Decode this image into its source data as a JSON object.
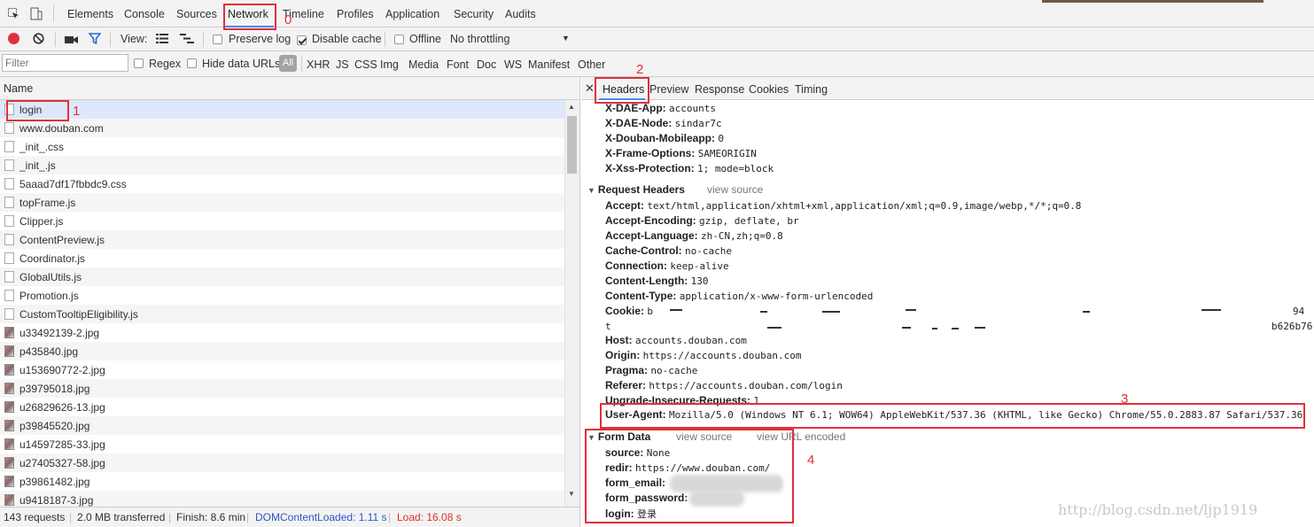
{
  "devtools": {
    "tabs": [
      "Elements",
      "Console",
      "Sources",
      "Network",
      "Timeline",
      "Profiles",
      "Application",
      "Security",
      "Audits"
    ],
    "active_tab": "Network"
  },
  "controls": {
    "view_label": "View:",
    "preserve_log": "Preserve log",
    "disable_cache": "Disable cache",
    "offline": "Offline",
    "throttling": "No throttling"
  },
  "filter": {
    "placeholder": "Filter",
    "regex": "Regex",
    "hide_data_urls": "Hide data URLs",
    "types": [
      "All",
      "XHR",
      "JS",
      "CSS",
      "Img",
      "Media",
      "Font",
      "Doc",
      "WS",
      "Manifest",
      "Other"
    ]
  },
  "requests": {
    "column_name": "Name",
    "items": [
      {
        "name": "login",
        "kind": "doc"
      },
      {
        "name": "www.douban.com",
        "kind": "doc"
      },
      {
        "name": "_init_.css",
        "kind": "doc"
      },
      {
        "name": "_init_.js",
        "kind": "doc"
      },
      {
        "name": "5aaad7df17fbbdc9.css",
        "kind": "doc"
      },
      {
        "name": "topFrame.js",
        "kind": "doc"
      },
      {
        "name": "Clipper.js",
        "kind": "doc"
      },
      {
        "name": "ContentPreview.js",
        "kind": "doc"
      },
      {
        "name": "Coordinator.js",
        "kind": "doc"
      },
      {
        "name": "GlobalUtils.js",
        "kind": "doc"
      },
      {
        "name": "Promotion.js",
        "kind": "doc"
      },
      {
        "name": "CustomTooltipEligibility.js",
        "kind": "doc"
      },
      {
        "name": "u33492139-2.jpg",
        "kind": "img"
      },
      {
        "name": "p435840.jpg",
        "kind": "img"
      },
      {
        "name": "u153690772-2.jpg",
        "kind": "img"
      },
      {
        "name": "p39795018.jpg",
        "kind": "img"
      },
      {
        "name": "u26829626-13.jpg",
        "kind": "img"
      },
      {
        "name": "p39845520.jpg",
        "kind": "img"
      },
      {
        "name": "u14597285-33.jpg",
        "kind": "img"
      },
      {
        "name": "u27405327-58.jpg",
        "kind": "img"
      },
      {
        "name": "p39861482.jpg",
        "kind": "img"
      },
      {
        "name": "u9418187-3.jpg",
        "kind": "img"
      }
    ]
  },
  "status": {
    "requests": "143 requests",
    "transferred": "2.0 MB transferred",
    "finish": "Finish: 8.6 min",
    "dom_content_loaded": "DOMContentLoaded: 1.11 s",
    "load": "Load: 16.08 s",
    "dcl_color": "#2a57c6",
    "load_color": "#d9312b"
  },
  "details": {
    "tabs": [
      "Headers",
      "Preview",
      "Response",
      "Cookies",
      "Timing"
    ],
    "active_tab": "Headers",
    "response_headers": [
      {
        "k": "X-DAE-App:",
        "v": "accounts"
      },
      {
        "k": "X-DAE-Node:",
        "v": "sindar7c"
      },
      {
        "k": "X-Douban-Mobileapp:",
        "v": "0"
      },
      {
        "k": "X-Frame-Options:",
        "v": "SAMEORIGIN"
      },
      {
        "k": "X-Xss-Protection:",
        "v": "1; mode=block"
      }
    ],
    "request_headers_title": "Request Headers",
    "view_source": "view source",
    "request_headers": [
      {
        "k": "Accept:",
        "v": "text/html,application/xhtml+xml,application/xml;q=0.9,image/webp,*/*;q=0.8"
      },
      {
        "k": "Accept-Encoding:",
        "v": "gzip, deflate, br"
      },
      {
        "k": "Accept-Language:",
        "v": "zh-CN,zh;q=0.8"
      },
      {
        "k": "Cache-Control:",
        "v": "no-cache"
      },
      {
        "k": "Connection:",
        "v": "keep-alive"
      },
      {
        "k": "Content-Length:",
        "v": "130"
      },
      {
        "k": "Content-Type:",
        "v": "application/x-www-form-urlencoded"
      },
      {
        "k": "Cookie:",
        "v": "b"
      }
    ],
    "cookie_line2": "t",
    "cookie_right1": "94",
    "cookie_right2": "b626b76",
    "request_headers_2": [
      {
        "k": "Host:",
        "v": "accounts.douban.com"
      },
      {
        "k": "Origin:",
        "v": "https://accounts.douban.com"
      },
      {
        "k": "Pragma:",
        "v": "no-cache"
      },
      {
        "k": "Referer:",
        "v": "https://accounts.douban.com/login"
      },
      {
        "k": "Upgrade-Insecure-Requests:",
        "v": "1"
      }
    ],
    "user_agent": {
      "k": "User-Agent:",
      "v": "Mozilla/5.0 (Windows NT 6.1; WOW64) AppleWebKit/537.36 (KHTML, like Gecko) Chrome/55.0.2883.87 Safari/537.36"
    },
    "form_data_title": "Form Data",
    "view_url_encoded": "view URL encoded",
    "form_data": [
      {
        "k": "source:",
        "v": "None"
      },
      {
        "k": "redir:",
        "v": "https://www.douban.com/"
      },
      {
        "k": "form_email:",
        "v": ""
      },
      {
        "k": "form_password:",
        "v": ""
      },
      {
        "k": "login:",
        "v": "登录"
      }
    ]
  },
  "annotations": [
    "0",
    "1",
    "2",
    "3",
    "4"
  ],
  "watermark": "http://blog.csdn.net/ljp1919",
  "accent_red": "#e0303a"
}
